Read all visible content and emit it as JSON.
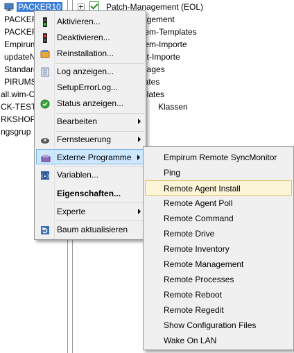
{
  "tree_left": {
    "selected": "PACKER10",
    "items": [
      "PACKER",
      "PACKER",
      "Empirum",
      "updateN",
      "Standard",
      "PIRUMSE",
      "all.wim-C",
      "CK-TEST",
      "RKSHOP",
      "ngsgrup"
    ]
  },
  "tree_right": {
    "items": [
      "Patch-Management (EOL)",
      "agement",
      "tem-Templates",
      "tem-Importe",
      "et-Importe",
      "nages",
      "lates",
      "plates",
      "Klassen"
    ]
  },
  "context_menu": {
    "items": [
      {
        "label": "Aktivieren...",
        "icon": "traffic-light-green-icon"
      },
      {
        "label": "Deaktivieren...",
        "icon": "traffic-light-red-icon"
      },
      {
        "label": "Reinstallation...",
        "icon": "reinstall-icon"
      },
      {
        "label": "Log anzeigen...",
        "icon": "log-icon"
      },
      {
        "label": "SetupErrorLog...",
        "icon": ""
      },
      {
        "label": "Status anzeigen...",
        "icon": "status-icon"
      },
      {
        "label": "Bearbeiten",
        "icon": ""
      },
      {
        "label": "Fernsteuerung",
        "icon": "remote-control-icon"
      },
      {
        "label": "Externe Programme",
        "icon": "external-programs-icon"
      },
      {
        "label": "Variablen...",
        "icon": "variables-icon"
      },
      {
        "label": "Eigenschaften...",
        "icon": ""
      },
      {
        "label": "Experte",
        "icon": ""
      },
      {
        "label": "Baum aktualisieren",
        "icon": "refresh-icon"
      }
    ]
  },
  "submenu": {
    "items": [
      "Empirum Remote SyncMonitor",
      "Ping",
      "Remote Agent Install",
      "Remote Agent Poll",
      "Remote Command",
      "Remote Drive",
      "Remote Inventory",
      "Remote Management",
      "Remote Processes",
      "Remote Reboot",
      "Remote Regedit",
      "Show Configuration Files",
      "Wake On LAN"
    ],
    "highlighted": "Remote Agent Install"
  }
}
